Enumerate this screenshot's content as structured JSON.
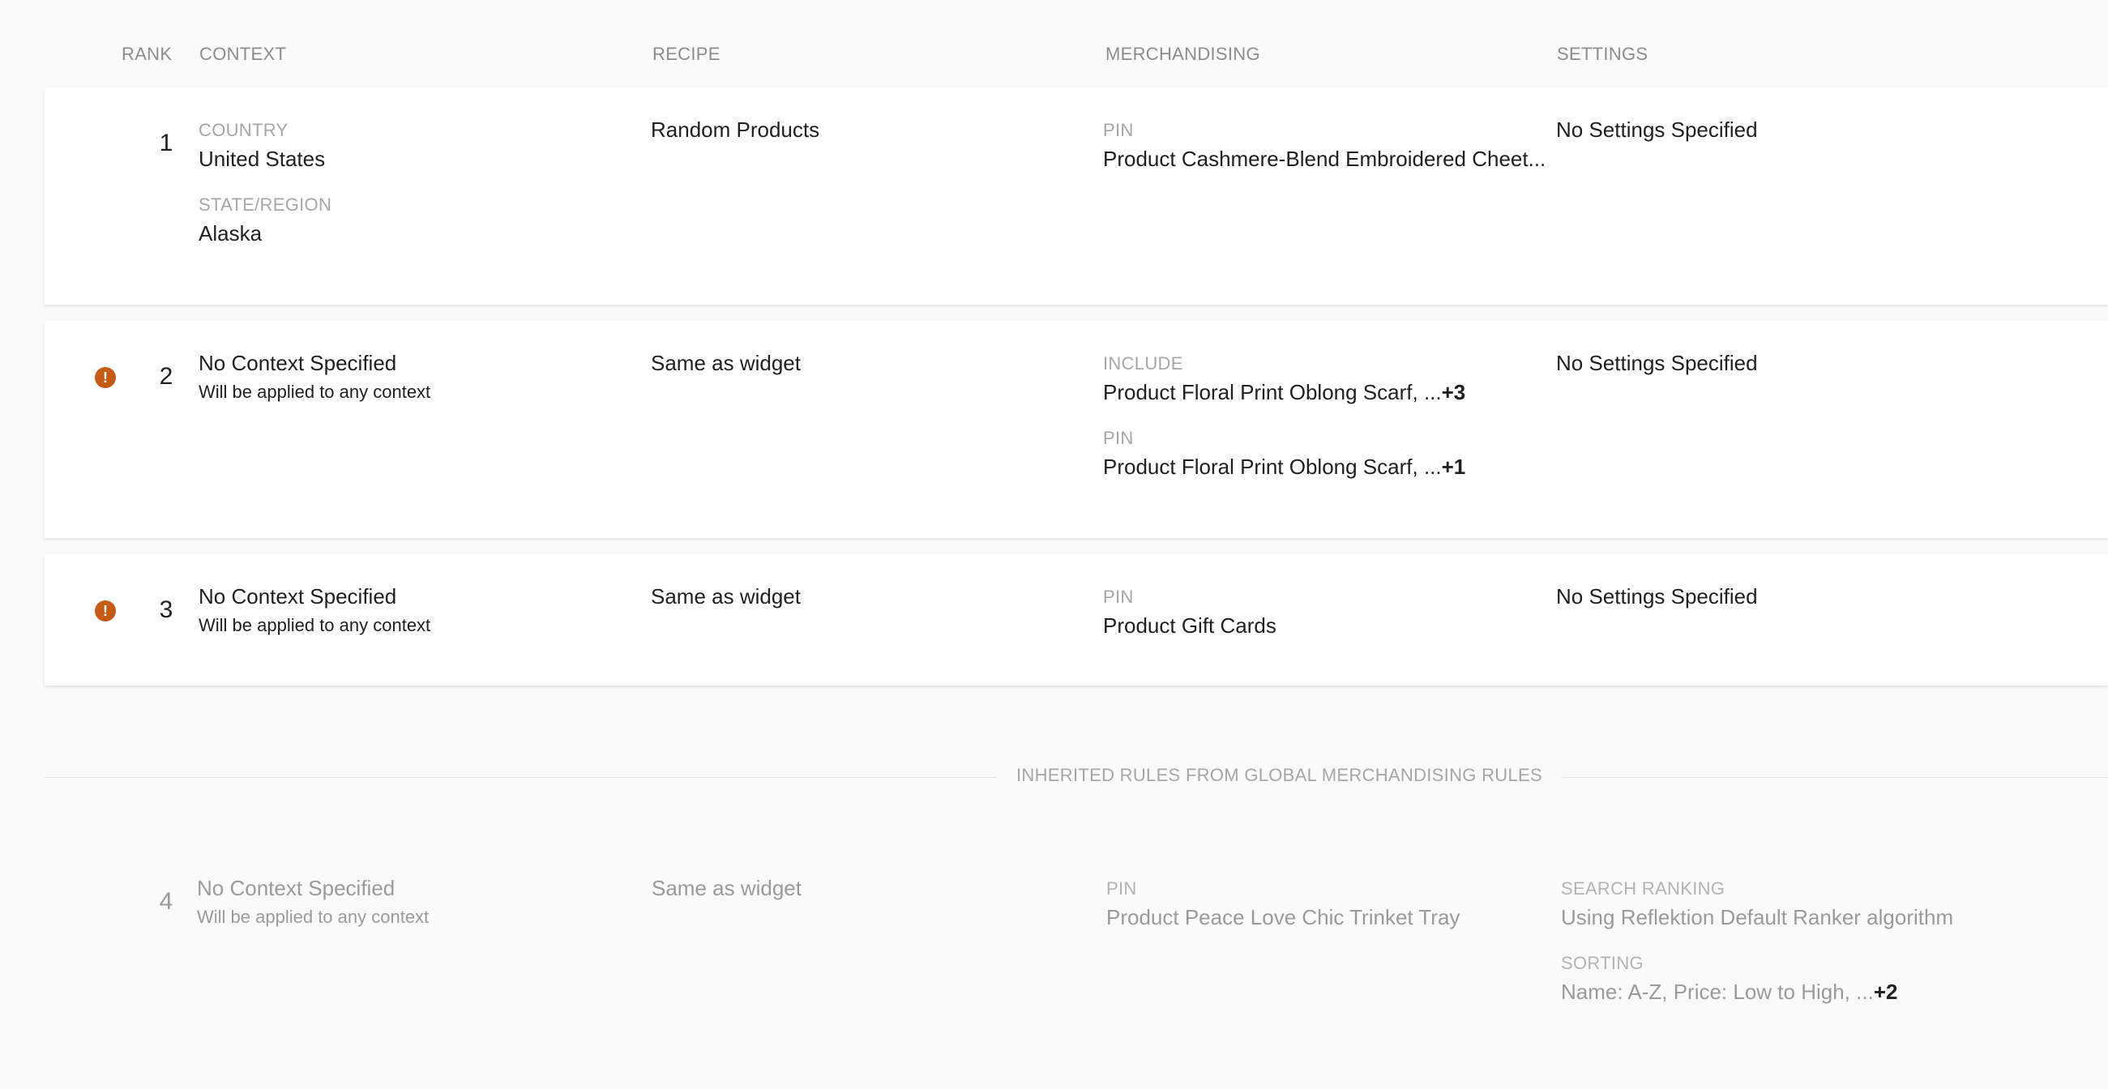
{
  "header": {
    "rank": "RANK",
    "context": "CONTEXT",
    "recipe": "RECIPE",
    "merchandising": "MERCHANDISING",
    "settings": "SETTINGS"
  },
  "rules": [
    {
      "rank": "1",
      "context_label_1": "COUNTRY",
      "context_value_1": "United States",
      "context_label_2": "STATE/REGION",
      "context_value_2": "Alaska",
      "recipe": "Random Products",
      "merch_label_1": "PIN",
      "merch_value_1": "Product Cashmere-Blend Embroidered Cheet...",
      "settings": "No Settings Specified"
    },
    {
      "rank": "2",
      "warning": "!",
      "context": "No Context Specified",
      "context_sub": "Will be applied to any context",
      "recipe": "Same as widget",
      "merch_label_1": "INCLUDE",
      "merch_value_1": "Product Floral Print Oblong Scarf, ...",
      "merch_more_1": "+3",
      "merch_label_2": "PIN",
      "merch_value_2": "Product Floral Print Oblong Scarf, ...",
      "merch_more_2": "+1",
      "settings": "No Settings Specified"
    },
    {
      "rank": "3",
      "warning": "!",
      "context": "No Context Specified",
      "context_sub": "Will be applied to any context",
      "recipe": "Same as widget",
      "merch_label_1": "PIN",
      "merch_value_1": "Product Gift Cards",
      "settings": "No Settings Specified"
    }
  ],
  "divider": "INHERITED RULES FROM GLOBAL MERCHANDISING RULES",
  "inherited": {
    "rank": "4",
    "context": "No Context Specified",
    "context_sub": "Will be applied to any context",
    "recipe": "Same as widget",
    "merch_label_1": "PIN",
    "merch_value_1": "Product Peace Love Chic Trinket Tray",
    "settings_label_1": "SEARCH RANKING",
    "settings_value_1": "Using Reflektion Default Ranker algorithm",
    "settings_label_2": "SORTING",
    "settings_value_2": "Name: A-Z, Price: Low to High, ...",
    "settings_more_2": "+2"
  },
  "colors": {
    "warning": "#c45b16",
    "background": "#fafafa",
    "card": "#ffffff"
  }
}
